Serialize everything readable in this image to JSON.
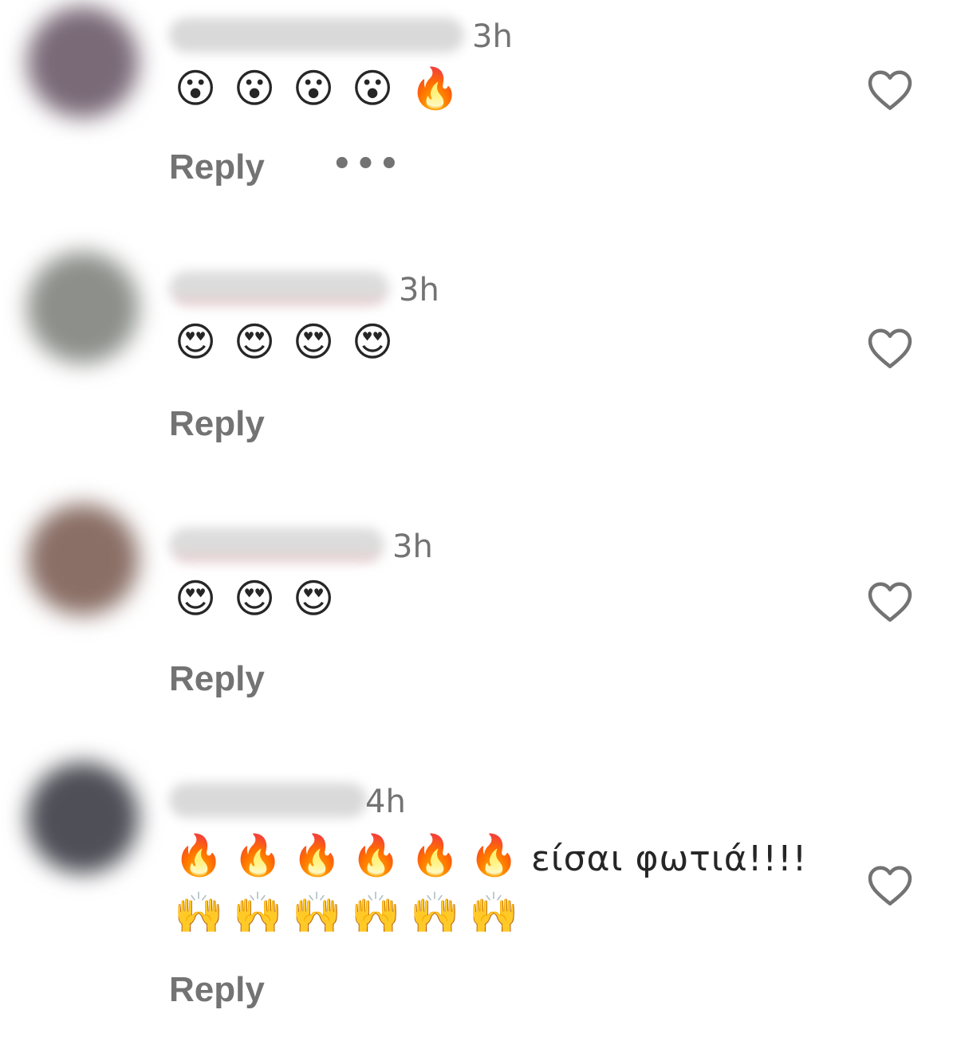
{
  "comments": [
    {
      "time": "3h",
      "emojis": [
        "😮",
        "😮",
        "😮",
        "😮",
        "🔥"
      ],
      "text": "",
      "emojis2": [],
      "reply_label": "Reply",
      "more_label": "•••",
      "avatar_color": "#7a6a78"
    },
    {
      "time": "3h",
      "emojis": [
        "😍",
        "😍",
        "😍",
        "😍"
      ],
      "text": "",
      "emojis2": [],
      "reply_label": "Reply",
      "avatar_color": "#8c8f8a"
    },
    {
      "time": "3h",
      "emojis": [
        "😍",
        "😍",
        "😍"
      ],
      "text": "",
      "emojis2": [],
      "reply_label": "Reply",
      "avatar_color": "#8a6f66"
    },
    {
      "time": "4h",
      "emojis": [
        "🔥",
        "🔥",
        "🔥",
        "🔥",
        "🔥",
        "🔥"
      ],
      "text": "είσαι φωτιά!!!!",
      "emojis2": [
        "🙌",
        "🙌",
        "🙌",
        "🙌",
        "🙌",
        "🙌"
      ],
      "reply_label": "Reply",
      "avatar_color": "#4e4f57"
    }
  ],
  "colors": {
    "secondary_text": "#737373",
    "primary_text": "#262626",
    "background": "#ffffff"
  },
  "icons": {
    "like": "heart-outline-icon",
    "more": "more-options-icon"
  }
}
